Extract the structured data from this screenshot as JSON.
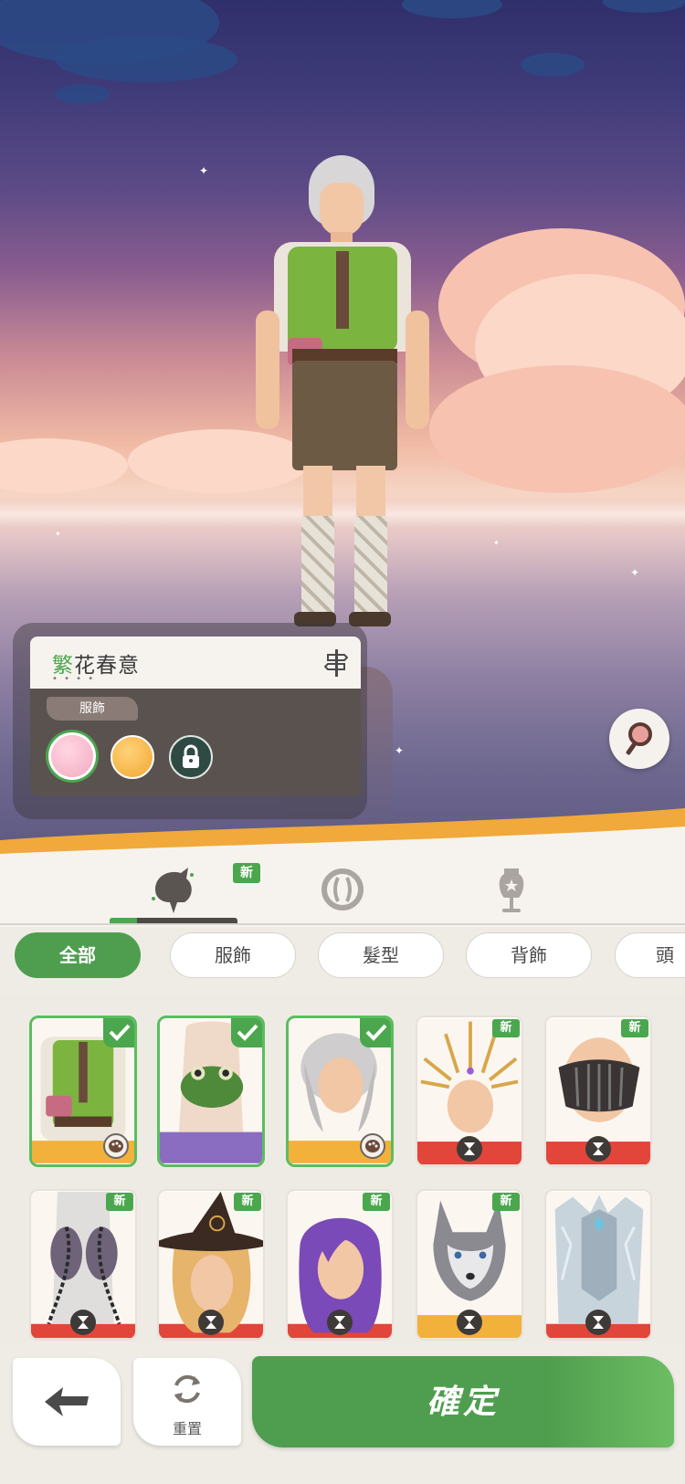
{
  "outfit": {
    "name_accent": "繁",
    "name_rest": "花春意",
    "dots": "• • • •",
    "tag": "服飾"
  },
  "tabs": [
    {
      "icon": "wardrobe-creature-icon",
      "new_badge": "新",
      "active": true
    },
    {
      "icon": "magic-orb-icon",
      "active": false
    },
    {
      "icon": "mannequin-icon",
      "active": false
    }
  ],
  "filters": [
    "全部",
    "服飾",
    "髮型",
    "背飾",
    "頭"
  ],
  "items": [
    {
      "name": "outfit-green-suspenders",
      "selected": true,
      "badge": "palette"
    },
    {
      "name": "frog-backpack",
      "selected": true,
      "badge": ""
    },
    {
      "name": "silver-curly-hair",
      "selected": true,
      "badge": "palette"
    },
    {
      "name": "golden-halo-crown",
      "new": "新",
      "badge": "hourglass"
    },
    {
      "name": "dark-visor-mask",
      "new": "新",
      "badge": "hourglass"
    },
    {
      "name": "chained-gauntlets",
      "new": "新",
      "badge": "hourglass"
    },
    {
      "name": "witch-hat-blonde-hair",
      "new": "新",
      "badge": "hourglass"
    },
    {
      "name": "purple-long-hair",
      "new": "新",
      "badge": "hourglass"
    },
    {
      "name": "wolf-pelt-hood",
      "new": "新",
      "badge": "hourglass"
    },
    {
      "name": "crystal-armor",
      "badge": "hourglass"
    }
  ],
  "footer": {
    "reset_label": "重置",
    "confirm_label": "確定"
  },
  "colors": {
    "accent_green": "#4aa74e",
    "panel_bg": "#f6f3ee"
  }
}
